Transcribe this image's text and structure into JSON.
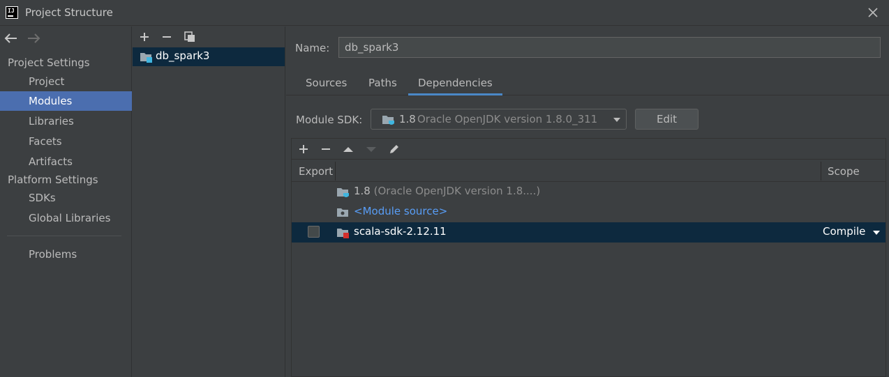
{
  "window": {
    "title": "Project Structure",
    "app_icon": "intellij-idea-icon",
    "close_icon": "close-icon"
  },
  "nav": {
    "back_icon": "arrow-left-icon",
    "forward_icon": "arrow-right-icon",
    "project_settings_header": "Project Settings",
    "project_settings_items": [
      {
        "label": "Project",
        "selected": false
      },
      {
        "label": "Modules",
        "selected": true
      },
      {
        "label": "Libraries",
        "selected": false
      },
      {
        "label": "Facets",
        "selected": false
      },
      {
        "label": "Artifacts",
        "selected": false
      }
    ],
    "platform_settings_header": "Platform Settings",
    "platform_settings_items": [
      {
        "label": "SDKs"
      },
      {
        "label": "Global Libraries"
      }
    ],
    "problems_label": "Problems"
  },
  "modules": {
    "toolbar_icons": [
      "add-icon",
      "remove-icon",
      "copy-icon"
    ],
    "items": [
      {
        "label": "db_spark3",
        "icon": "module-folder-icon",
        "selected": true
      }
    ]
  },
  "module_settings": {
    "name_label": "Name:",
    "name_value": "db_spark3",
    "tabs": [
      {
        "label": "Sources",
        "active": false
      },
      {
        "label": "Paths",
        "active": false
      },
      {
        "label": "Dependencies",
        "active": true
      }
    ],
    "sdk_label": "Module SDK:",
    "sdk_version": "1.8",
    "sdk_description": "Oracle OpenJDK version 1.8.0_311",
    "edit_label": "Edit",
    "dep_toolbar_icons": [
      "add-icon",
      "remove-icon",
      "move-up-icon",
      "move-down-icon",
      "edit-pencil-icon"
    ],
    "columns": {
      "export": "Export",
      "scope": "Scope"
    },
    "dependencies": [
      {
        "name": "1.8",
        "detail": "(Oracle OpenJDK version 1.8....)",
        "icon": "jdk-folder-icon"
      },
      {
        "name": "<Module source>",
        "icon": "module-source-folder-icon"
      },
      {
        "name": "scala-sdk-2.12.11",
        "icon": "library-icon",
        "exported": false,
        "scope": "Compile",
        "selected": true
      }
    ]
  },
  "colors": {
    "background": "#3c3f41",
    "selection": "#4b6eaf",
    "row_selection": "#0d293e",
    "link": "#589df6",
    "tab_underline": "#4a88c7"
  }
}
